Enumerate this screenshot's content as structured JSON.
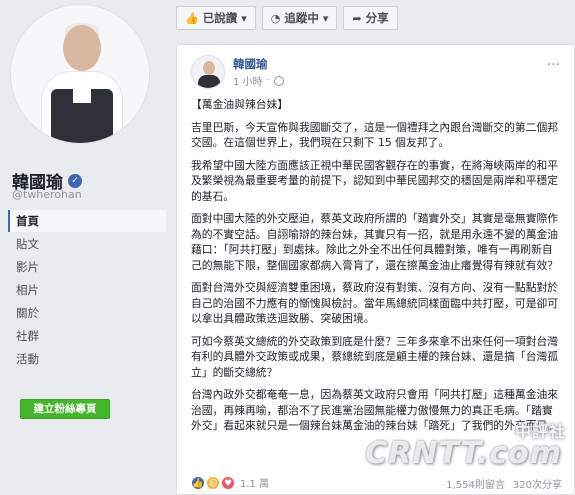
{
  "profile": {
    "name": "韓國瑜",
    "handle": "@twherohan"
  },
  "nav": {
    "items": [
      "首頁",
      "貼文",
      "影片",
      "相片",
      "關於",
      "社群",
      "活動"
    ],
    "create_label": "建立粉絲專頁"
  },
  "actions": {
    "liked": "已說讚",
    "following": "追蹤中",
    "share": "分享"
  },
  "post": {
    "author": "韓國瑜",
    "time": "1 小時",
    "paragraphs": [
      "【萬金油與辣台妹】",
      "吉里巴斯，今天宣佈與我國斷交了，這是一個禮拜之內跟台灣斷交的第二個邦交國。在這個世界上，我們現在只剩下 15 個友邦了。",
      "我希望中國大陸方面應該正視中華民國客觀存在的事實，在將海峽兩岸的和平及繁榮視為最重要考量的前提下，認知到中華民國邦交的穩固是兩岸和平穩定的基石。",
      "面對中國大陸的外交壓迫，蔡英文政府所謂的「踏實外交」其實是毫無實際作為的不實空話。自詡喻辯的辣台妹，其實只有一招，就是用永遠不變的萬金油藉口：「阿共打壓」到處抹。除此之外全不出任何具體對策，唯有一再刷新自己的無能下限，整個國家都病入膏肓了，還在擦萬金油止癢覺得有辣就有效？",
      "面對台灣外交與經濟雙重困境，蔡政府沒有對策、沒有方向、沒有一點點對於自己的治國不力應有的慚愧與檢討。當年馬總統同樣面臨中共打壓，可是卻可以拿出具體政策迭迴致勝、突破困境。",
      "可如今蔡英文總統的外交政策到底是什麼？三年多來拿不出來任何一項對台灣有利的具體外交政策或成果，蔡總統到底是顧主權的辣台妹、還是搞「台灣孤立」的斷交總統？",
      "台灣內政外交都奄奄一息，因為蔡英文政府只會用「阿共打壓」這種萬金油來治國，再辣再喻，都治不了民進黨治國無能權力傲慢無力的真正毛病。「踏實外交」看起來就只是一個辣台妹萬金油的辣台妹「踏死」了我們的外交而已。"
    ],
    "reaction_count": "1.1 萬",
    "comments": "1,554則留言",
    "shares": "320次分享"
  },
  "watermark": {
    "top": "中評社",
    "main": "CRNTT.com"
  },
  "icons": {
    "like": "thumbs-up-icon",
    "follow": "rss-icon",
    "share": "share-arrow-icon",
    "verified": "verified-check-icon",
    "privacy": "globe-icon",
    "more": "more-dots-icon"
  },
  "colors": {
    "brand_blue": "#4267b2",
    "link_blue": "#365899",
    "create_green": "#42b72a",
    "page_bg": "#e9ebee"
  }
}
